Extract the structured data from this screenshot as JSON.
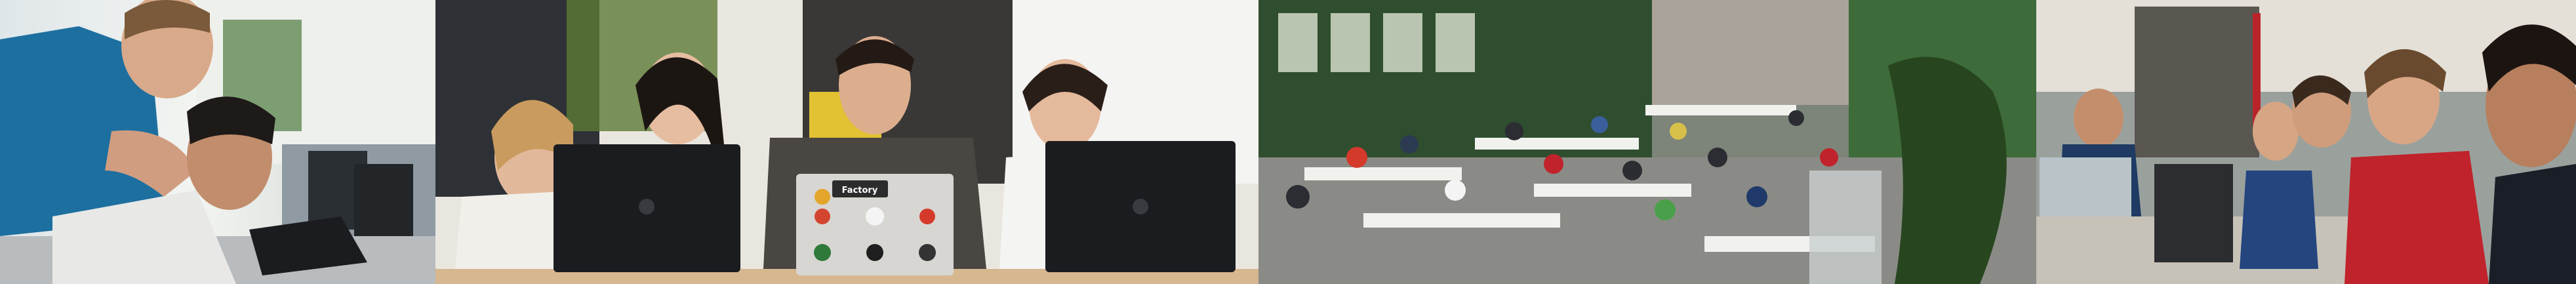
{
  "collage": {
    "panel_count": 4,
    "panels": [
      {
        "id": "panel-1",
        "scene": "student-watching-peer-at-laptop",
        "tone": "cool-blue"
      },
      {
        "id": "panel-2",
        "scene": "four-students-sharing-laptops",
        "tone": "neutral-warm"
      },
      {
        "id": "panel-3",
        "scene": "large-coding-hall",
        "tone": "green-industrial"
      },
      {
        "id": "panel-4",
        "scene": "students-concentrating-at-tables",
        "tone": "teal-red"
      }
    ]
  },
  "laptop_sticker_text": "Factory",
  "colors": {
    "blue_shirt": "#1d6fa0",
    "hp_laptop": "#1b1c1f",
    "silver_laptop": "#d8d6d2",
    "hall_green": "#3d6b3a",
    "red_shirt": "#c0232b"
  }
}
